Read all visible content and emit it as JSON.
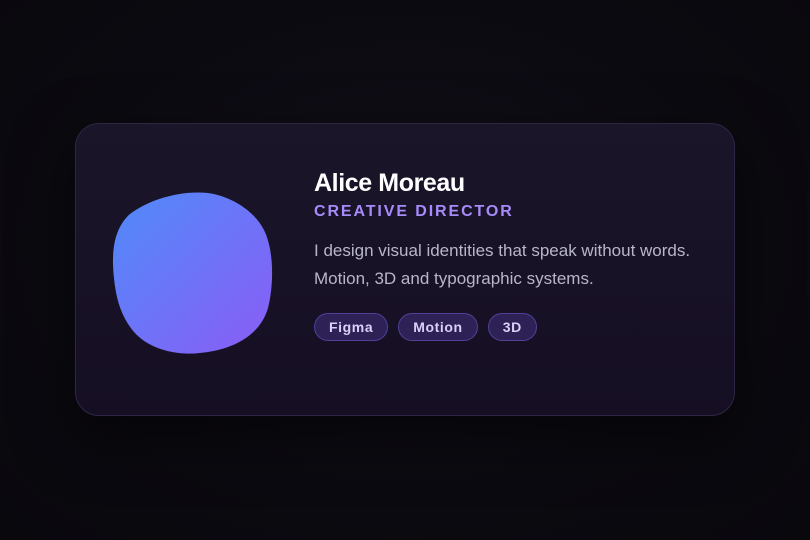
{
  "profile": {
    "name": "Alice Moreau",
    "role": "CREATIVE DIRECTOR",
    "bio": "I design visual identities that speak without words. Motion, 3D and typographic systems.",
    "tags": [
      "Figma",
      "Motion",
      "3D"
    ]
  },
  "avatar": {
    "icon": "gradient-blob",
    "gradient_start": "#4f8bf9",
    "gradient_end": "#8b5cf6"
  },
  "colors": {
    "background": "#0b0a10",
    "card": "#181226",
    "accent": "#a78bfa",
    "tag_background": "#2d2156"
  }
}
